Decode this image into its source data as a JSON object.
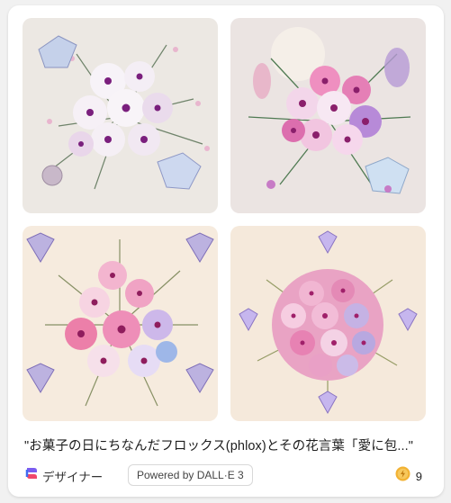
{
  "caption": "\"お菓子の日にちなんだフロックス(phlox)とその花言葉「愛に包...\"",
  "footer": {
    "brand_label": "デザイナー",
    "brand_icon": "designer-logo-icon",
    "powered_label": "Powered by DALL·E 3",
    "boost_icon": "boost-coin-icon",
    "boost_count": "9"
  },
  "images": [
    {
      "name": "generated-image-1"
    },
    {
      "name": "generated-image-2"
    },
    {
      "name": "generated-image-3"
    },
    {
      "name": "generated-image-4"
    }
  ]
}
